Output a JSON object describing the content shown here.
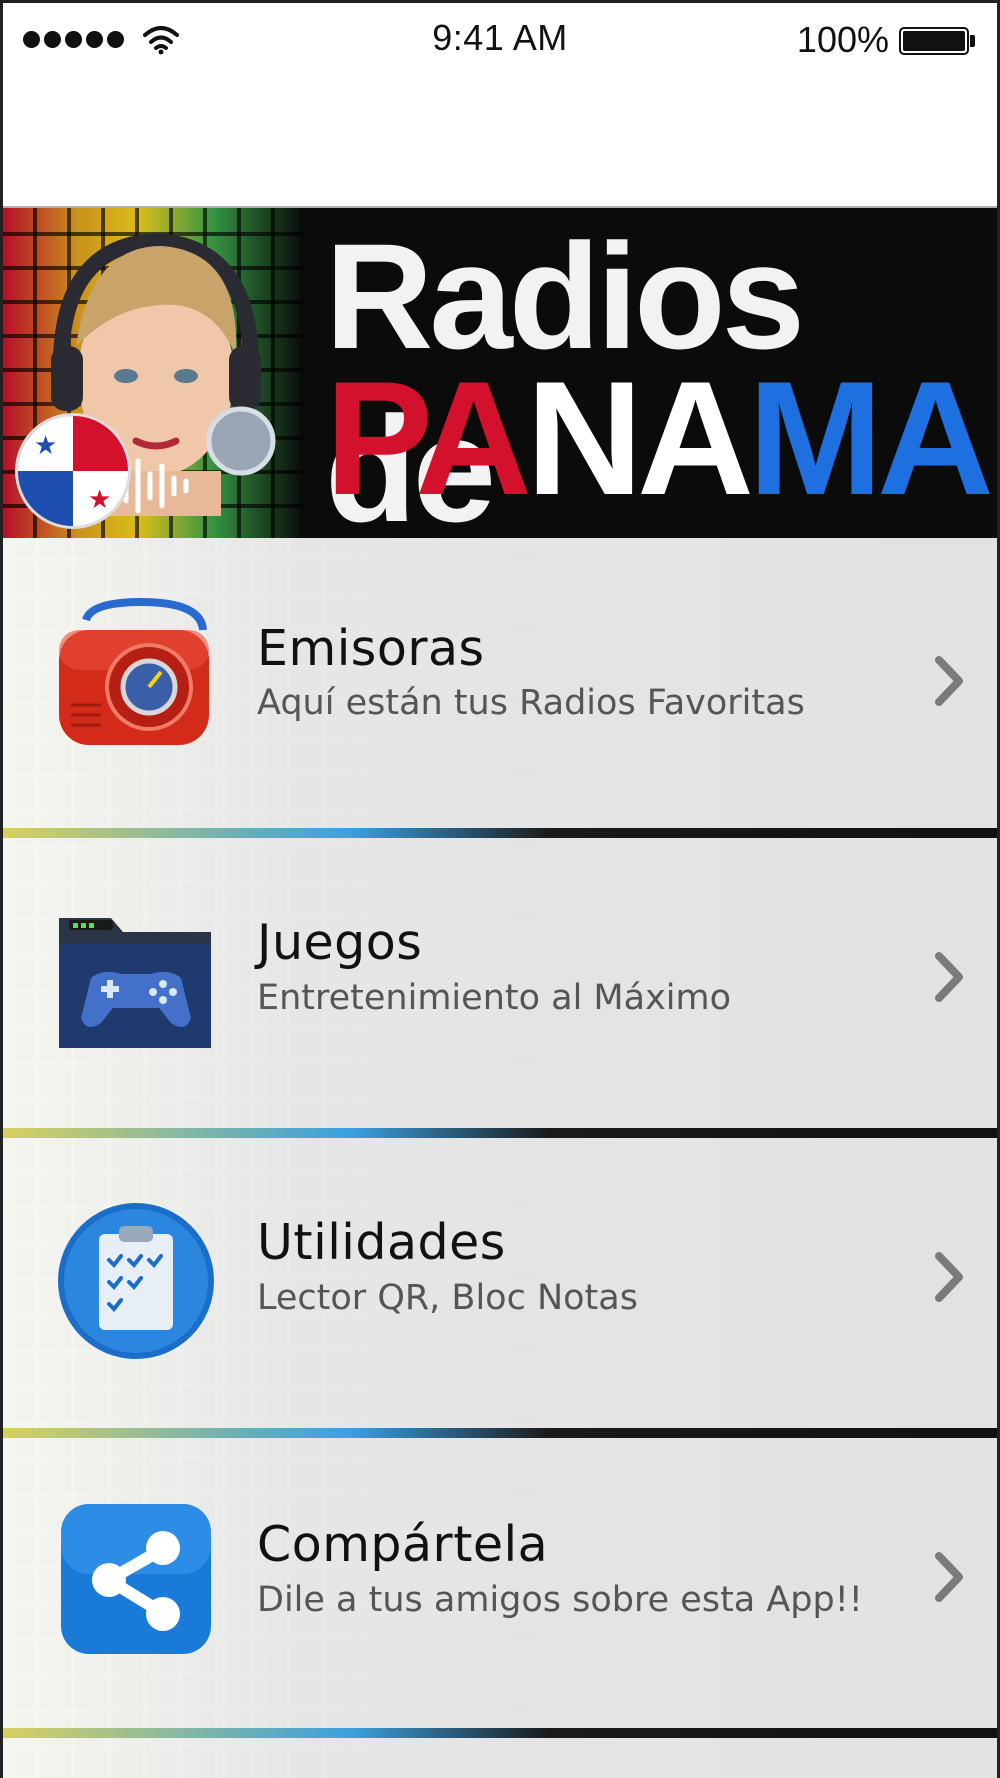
{
  "status_bar": {
    "time": "9:41 AM",
    "battery": "100%",
    "signal_bars": 5
  },
  "banner": {
    "title": "Radios de",
    "subtitle_parts": [
      "PA",
      "NA",
      "MA"
    ],
    "colors": {
      "pa": "#d4112c",
      "na": "#ffffff",
      "ma": "#1e6fe0"
    }
  },
  "menu": {
    "items": [
      {
        "title": "Emisoras",
        "subtitle": "Aquí están tus Radios Favoritas",
        "icon": "radio-icon"
      },
      {
        "title": "Juegos",
        "subtitle": "Entretenimiento al Máximo",
        "icon": "game-controller-folder-icon"
      },
      {
        "title": "Utilidades",
        "subtitle": "Lector QR, Bloc Notas",
        "icon": "clipboard-checklist-icon"
      },
      {
        "title": "Compártela",
        "subtitle": "Dile a tus amigos sobre esta App!!",
        "icon": "share-icon"
      }
    ]
  }
}
